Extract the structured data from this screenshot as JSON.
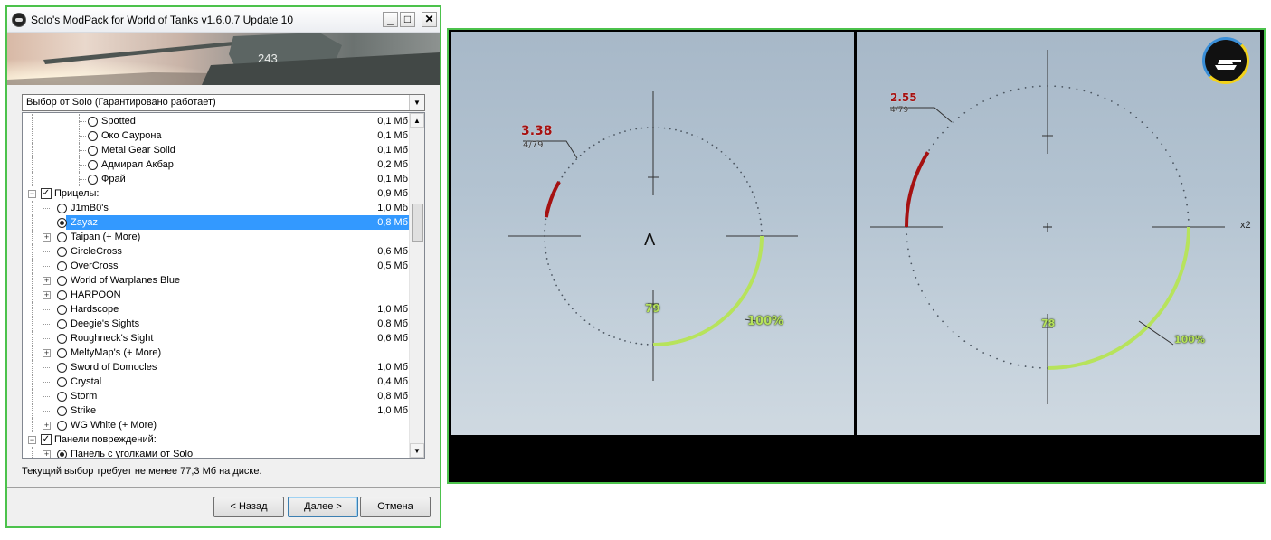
{
  "window": {
    "title": "Solo's ModPack for World of Tanks v1.6.0.7 Update 10",
    "banner_number": "243",
    "controls": {
      "minimize": "_",
      "maximize": "□",
      "close": "✕"
    }
  },
  "dropdown": {
    "value": "Выбор от Solo (Гарантировано работает)"
  },
  "tree": [
    {
      "label": "Spotted",
      "size": "0,1 Мб",
      "level": 3,
      "control": "radio",
      "checked": false,
      "expander": null,
      "selected": false
    },
    {
      "label": "Око Саурона",
      "size": "0,1 Мб",
      "level": 3,
      "control": "radio",
      "checked": false,
      "expander": null,
      "selected": false
    },
    {
      "label": "Metal Gear Solid",
      "size": "0,1 Мб",
      "level": 3,
      "control": "radio",
      "checked": false,
      "expander": null,
      "selected": false
    },
    {
      "label": "Адмирал Акбар",
      "size": "0,2 Мб",
      "level": 3,
      "control": "radio",
      "checked": false,
      "expander": null,
      "selected": false
    },
    {
      "label": "Фрай",
      "size": "0,1 Мб",
      "level": 3,
      "control": "radio",
      "checked": false,
      "expander": null,
      "selected": false
    },
    {
      "label": "Прицелы:",
      "size": "0,9 Мб",
      "level": 1,
      "control": "check",
      "checked": true,
      "expander": "-",
      "selected": false
    },
    {
      "label": "J1mB0's",
      "size": "1,0 Мб",
      "level": 2,
      "control": "radio",
      "checked": false,
      "expander": null,
      "selected": false
    },
    {
      "label": "Zayaz",
      "size": "0,8 Мб",
      "level": 2,
      "control": "radio",
      "checked": true,
      "expander": null,
      "selected": true
    },
    {
      "label": "Taipan (+ More)",
      "size": "",
      "level": 2,
      "control": "radio",
      "checked": false,
      "expander": "+",
      "selected": false
    },
    {
      "label": "CircleCross",
      "size": "0,6 Мб",
      "level": 2,
      "control": "radio",
      "checked": false,
      "expander": null,
      "selected": false
    },
    {
      "label": "OverCross",
      "size": "0,5 Мб",
      "level": 2,
      "control": "radio",
      "checked": false,
      "expander": null,
      "selected": false
    },
    {
      "label": "World of Warplanes Blue",
      "size": "",
      "level": 2,
      "control": "radio",
      "checked": false,
      "expander": "+",
      "selected": false
    },
    {
      "label": "HARPOON",
      "size": "",
      "level": 2,
      "control": "radio",
      "checked": false,
      "expander": "+",
      "selected": false
    },
    {
      "label": "Hardscope",
      "size": "1,0 Мб",
      "level": 2,
      "control": "radio",
      "checked": false,
      "expander": null,
      "selected": false
    },
    {
      "label": "Deegie's Sights",
      "size": "0,8 Мб",
      "level": 2,
      "control": "radio",
      "checked": false,
      "expander": null,
      "selected": false
    },
    {
      "label": "Roughneck's Sight",
      "size": "0,6 Мб",
      "level": 2,
      "control": "radio",
      "checked": false,
      "expander": null,
      "selected": false
    },
    {
      "label": "MeltyMap's (+ More)",
      "size": "",
      "level": 2,
      "control": "radio",
      "checked": false,
      "expander": "+",
      "selected": false
    },
    {
      "label": "Sword of Domocles",
      "size": "1,0 Мб",
      "level": 2,
      "control": "radio",
      "checked": false,
      "expander": null,
      "selected": false
    },
    {
      "label": "Crystal",
      "size": "0,4 Мб",
      "level": 2,
      "control": "radio",
      "checked": false,
      "expander": null,
      "selected": false
    },
    {
      "label": "Storm",
      "size": "0,8 Мб",
      "level": 2,
      "control": "radio",
      "checked": false,
      "expander": null,
      "selected": false
    },
    {
      "label": "Strike",
      "size": "1,0 Мб",
      "level": 2,
      "control": "radio",
      "checked": false,
      "expander": null,
      "selected": false
    },
    {
      "label": "WG White (+ More)",
      "size": "",
      "level": 2,
      "control": "radio",
      "checked": false,
      "expander": "+",
      "selected": false
    },
    {
      "label": "Панели повреждений:",
      "size": "",
      "level": 1,
      "control": "check",
      "checked": true,
      "expander": "-",
      "selected": false
    },
    {
      "label": "Панель с уголками от Solo",
      "size": "",
      "level": 2,
      "control": "radio",
      "checked": true,
      "expander": "+",
      "selected": false
    }
  ],
  "disk_status": "Текущий выбор требует не менее 77,3 Мб на диске.",
  "buttons": {
    "back": "< Назад",
    "next": "Далее >",
    "cancel": "Отмена"
  },
  "preview": {
    "left": {
      "damage": "3.38",
      "hp": "4/79",
      "ammo": "79",
      "reload_pct": "100%",
      "center_mark": "Λ"
    },
    "right": {
      "damage": "2.55",
      "hp": "4/79",
      "ammo": "78",
      "reload_pct": "100%",
      "zoom": "x2"
    }
  },
  "colors": {
    "selection": "#3399ff",
    "frame": "#4cc24c",
    "reload_arc": "#b7e35c",
    "damage_arc": "#a51111"
  }
}
